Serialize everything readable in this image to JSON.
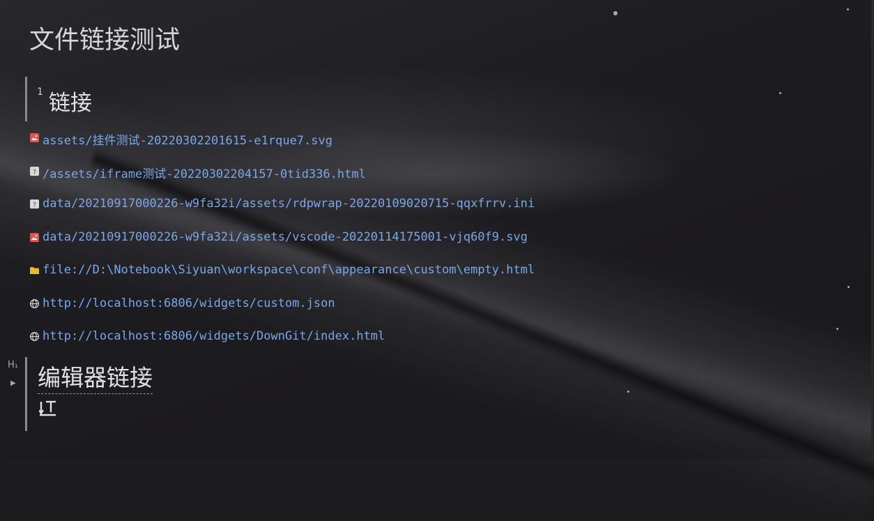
{
  "document": {
    "title": "文件链接测试"
  },
  "section_links": {
    "index": "1",
    "heading": "链接"
  },
  "links": [
    {
      "icon": "image-file-icon",
      "text": "assets/挂件测试-20220302201615-e1rque7.svg"
    },
    {
      "icon": "unknown-file-icon",
      "text": "/assets/iframe测试-20220302204157-0tid336.html"
    },
    {
      "icon": "unknown-file-icon",
      "text": "data/20210917000226-w9fa32i/assets/rdpwrap-20220109020715-qqxfrrv.ini"
    },
    {
      "icon": "image-file-icon",
      "text": "data/20210917000226-w9fa32i/assets/vscode-20220114175001-vjq60f9.svg"
    },
    {
      "icon": "folder-icon",
      "text": "file://D:\\Notebook\\Siyuan\\workspace\\conf\\appearance\\custom\\empty.html"
    },
    {
      "icon": "globe-icon",
      "text": "http://localhost:6806/widgets/custom.json"
    },
    {
      "icon": "globe-icon",
      "text": "http://localhost:6806/widgets/DownGit/index.html"
    }
  ],
  "section_editor": {
    "marker": "H₁",
    "heading": "编辑器链接"
  },
  "colors": {
    "link": "#7aa7ea",
    "image_icon": "#e0534f",
    "folder_icon": "#e8b93a",
    "text": "#e2e2e5"
  }
}
